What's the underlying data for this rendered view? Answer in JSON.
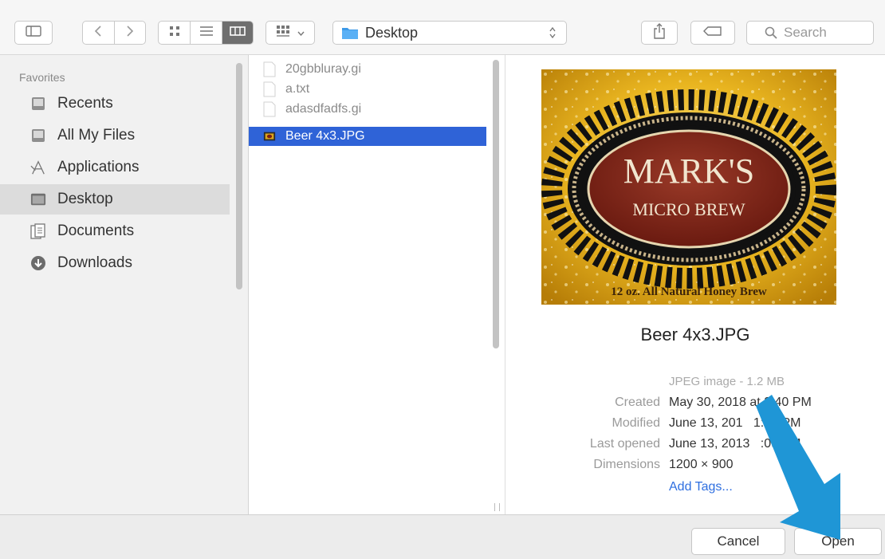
{
  "toolbar": {
    "location": "Desktop",
    "search_placeholder": "Search"
  },
  "sidebar": {
    "heading": "Favorites",
    "items": [
      {
        "label": "Recents",
        "icon": "recents-icon"
      },
      {
        "label": "All My Files",
        "icon": "all-files-icon"
      },
      {
        "label": "Applications",
        "icon": "applications-icon"
      },
      {
        "label": "Desktop",
        "icon": "desktop-icon",
        "selected": true
      },
      {
        "label": "Documents",
        "icon": "documents-icon"
      },
      {
        "label": "Downloads",
        "icon": "downloads-icon"
      }
    ]
  },
  "files": [
    {
      "name": "20gbbluray.gi",
      "icon": "document-icon"
    },
    {
      "name": "a.txt",
      "icon": "document-icon"
    },
    {
      "name": "adasdfadfs.gi",
      "icon": "document-icon"
    },
    {
      "name": "Beer 4x3.JPG",
      "icon": "image-file-icon",
      "selected": true
    }
  ],
  "preview": {
    "image": {
      "line1": "MARK'S",
      "line2": "MICRO BREW",
      "tagline": "12 oz. All Natural Honey Brew"
    },
    "filename": "Beer 4x3.JPG",
    "kind": "JPEG image - 1.2 MB",
    "created_label": "Created",
    "created": "May 30, 2018 at 3:40 PM",
    "modified_label": "Modified",
    "modified": "June 13, 201   1:09 PM",
    "last_opened_label": "Last opened",
    "last_opened": "June 13, 2013   :09 PM",
    "dimensions_label": "Dimensions",
    "dimensions": "1200 × 900",
    "add_tags": "Add Tags..."
  },
  "buttons": {
    "cancel": "Cancel",
    "open": "Open"
  },
  "colors": {
    "selection": "#2f63d7",
    "arrow": "#1f96d6",
    "folder": "#3d9ae8",
    "label_dark": "#7a1e14",
    "label_gold": "#e9b520"
  }
}
